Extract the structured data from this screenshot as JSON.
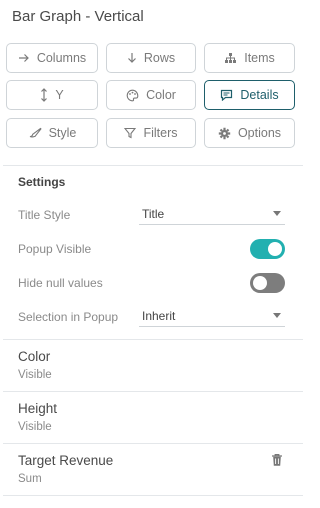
{
  "panel": {
    "title": "Bar Graph - Vertical"
  },
  "buttons": [
    {
      "label": "Columns",
      "icon": "arrow-right-icon"
    },
    {
      "label": "Rows",
      "icon": "arrow-down-icon"
    },
    {
      "label": "Items",
      "icon": "hierarchy-icon"
    },
    {
      "label": "Y",
      "icon": "vertical-arrows-icon"
    },
    {
      "label": "Color",
      "icon": "palette-icon"
    },
    {
      "label": "Details",
      "icon": "message-icon",
      "active": true
    },
    {
      "label": "Style",
      "icon": "brush-icon"
    },
    {
      "label": "Filters",
      "icon": "filter-icon"
    },
    {
      "label": "Options",
      "icon": "gear-icon"
    }
  ],
  "settings": {
    "heading": "Settings",
    "title_style": {
      "label": "Title Style",
      "value": "Title"
    },
    "popup_visible": {
      "label": "Popup Visible",
      "on": true
    },
    "hide_null": {
      "label": "Hide null values",
      "on": false
    },
    "selection_popup": {
      "label": "Selection in Popup",
      "value": "Inherit"
    }
  },
  "items": [
    {
      "name": "Color",
      "sub": "Visible"
    },
    {
      "name": "Height",
      "sub": "Visible"
    },
    {
      "name": "Target Revenue",
      "sub": "Sum"
    }
  ],
  "colors": {
    "accent": "#1e5f6b",
    "toggle_on": "#22b0b0",
    "toggle_off": "#7d7d7d"
  }
}
